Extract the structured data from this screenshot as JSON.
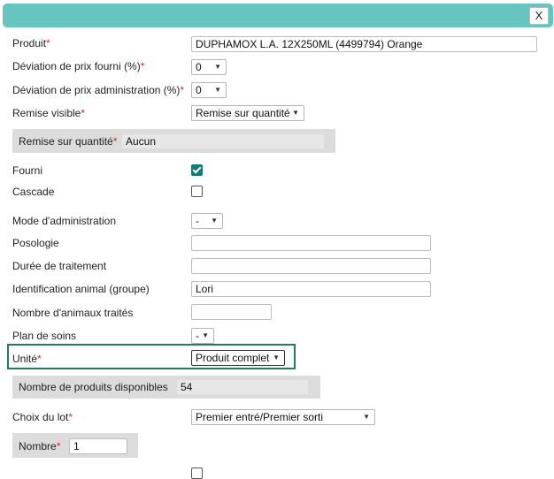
{
  "dialog": {
    "close_label": "X"
  },
  "form": {
    "produit": {
      "label": "Produit",
      "value": "DUPHAMOX L.A. 12X250ML (4499794) Orange"
    },
    "deviation_fourni": {
      "label": "Déviation de prix fourni (%)",
      "value": "0"
    },
    "deviation_admin": {
      "label": "Déviation de prix administration (%)",
      "value": "0"
    },
    "remise_visible": {
      "label": "Remise visible",
      "value": "Remise sur quantité"
    },
    "remise_panel": {
      "label": "Remise sur quantité",
      "value": "Aucun"
    },
    "fourni": {
      "label": "Fourni",
      "checked": true
    },
    "cascade": {
      "label": "Cascade",
      "checked": false
    },
    "mode_admin": {
      "label": "Mode d'administration",
      "value": "-"
    },
    "posologie": {
      "label": "Posologie",
      "value": ""
    },
    "duree": {
      "label": "Durée de traitement",
      "value": ""
    },
    "identification": {
      "label": "Identification animal (groupe)",
      "value": "Lori"
    },
    "nombre_animaux": {
      "label": "Nombre d'animaux traités",
      "value": ""
    },
    "plan_soins": {
      "label": "Plan de soins",
      "value": "-"
    },
    "unite": {
      "label": "Unité",
      "value": "Produit complet"
    },
    "disponibles_panel": {
      "label": "Nombre de produits disponibles",
      "value": "54"
    },
    "choix_lot": {
      "label": "Choix du lot",
      "value": "Premier entré/Premier sorti"
    },
    "nombre_panel": {
      "label": "Nombre",
      "value": "1"
    }
  },
  "colors": {
    "titlebar": "#66c6bf",
    "required": "#d9263a",
    "checkbox": "#137c74",
    "highlight": "#1f7f5c"
  }
}
